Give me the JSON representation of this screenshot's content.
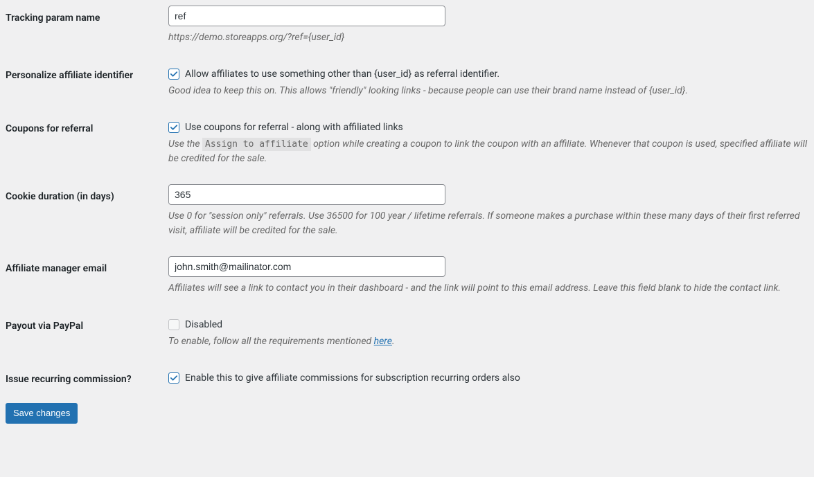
{
  "fields": {
    "tracking_param": {
      "label": "Tracking param name",
      "value": "ref",
      "description": "https://demo.storeapps.org/?ref={user_id}"
    },
    "personalize_identifier": {
      "label": "Personalize affiliate identifier",
      "checked": true,
      "checkbox_label": "Allow affiliates to use something other than {user_id} as referral identifier.",
      "description": "Good idea to keep this on. This allows \"friendly\" looking links - because people can use their brand name instead of {user_id}."
    },
    "coupons_referral": {
      "label": "Coupons for referral",
      "checked": true,
      "checkbox_label": "Use coupons for referral - along with affiliated links",
      "description_pre": "Use the ",
      "description_code": "Assign to affiliate",
      "description_post": " option while creating a coupon to link the coupon with an affiliate. Whenever that coupon is used, specified affiliate will be credited for the sale."
    },
    "cookie_duration": {
      "label": "Cookie duration (in days)",
      "value": "365",
      "description": "Use 0 for \"session only\" referrals. Use 36500 for 100 year / lifetime referrals. If someone makes a purchase within these many days of their first referred visit, affiliate will be credited for the sale."
    },
    "manager_email": {
      "label": "Affiliate manager email",
      "value": "john.smith@mailinator.com",
      "description": "Affiliates will see a link to contact you in their dashboard - and the link will point to this email address. Leave this field blank to hide the contact link."
    },
    "paypal": {
      "label": "Payout via PayPal",
      "checked": false,
      "disabled": true,
      "checkbox_label": "Disabled",
      "description_pre": "To enable, follow all the requirements mentioned ",
      "description_link": "here",
      "description_post": "."
    },
    "recurring": {
      "label": "Issue recurring commission?",
      "checked": true,
      "checkbox_label": "Enable this to give affiliate commissions for subscription recurring orders also"
    }
  },
  "buttons": {
    "save": "Save changes"
  }
}
